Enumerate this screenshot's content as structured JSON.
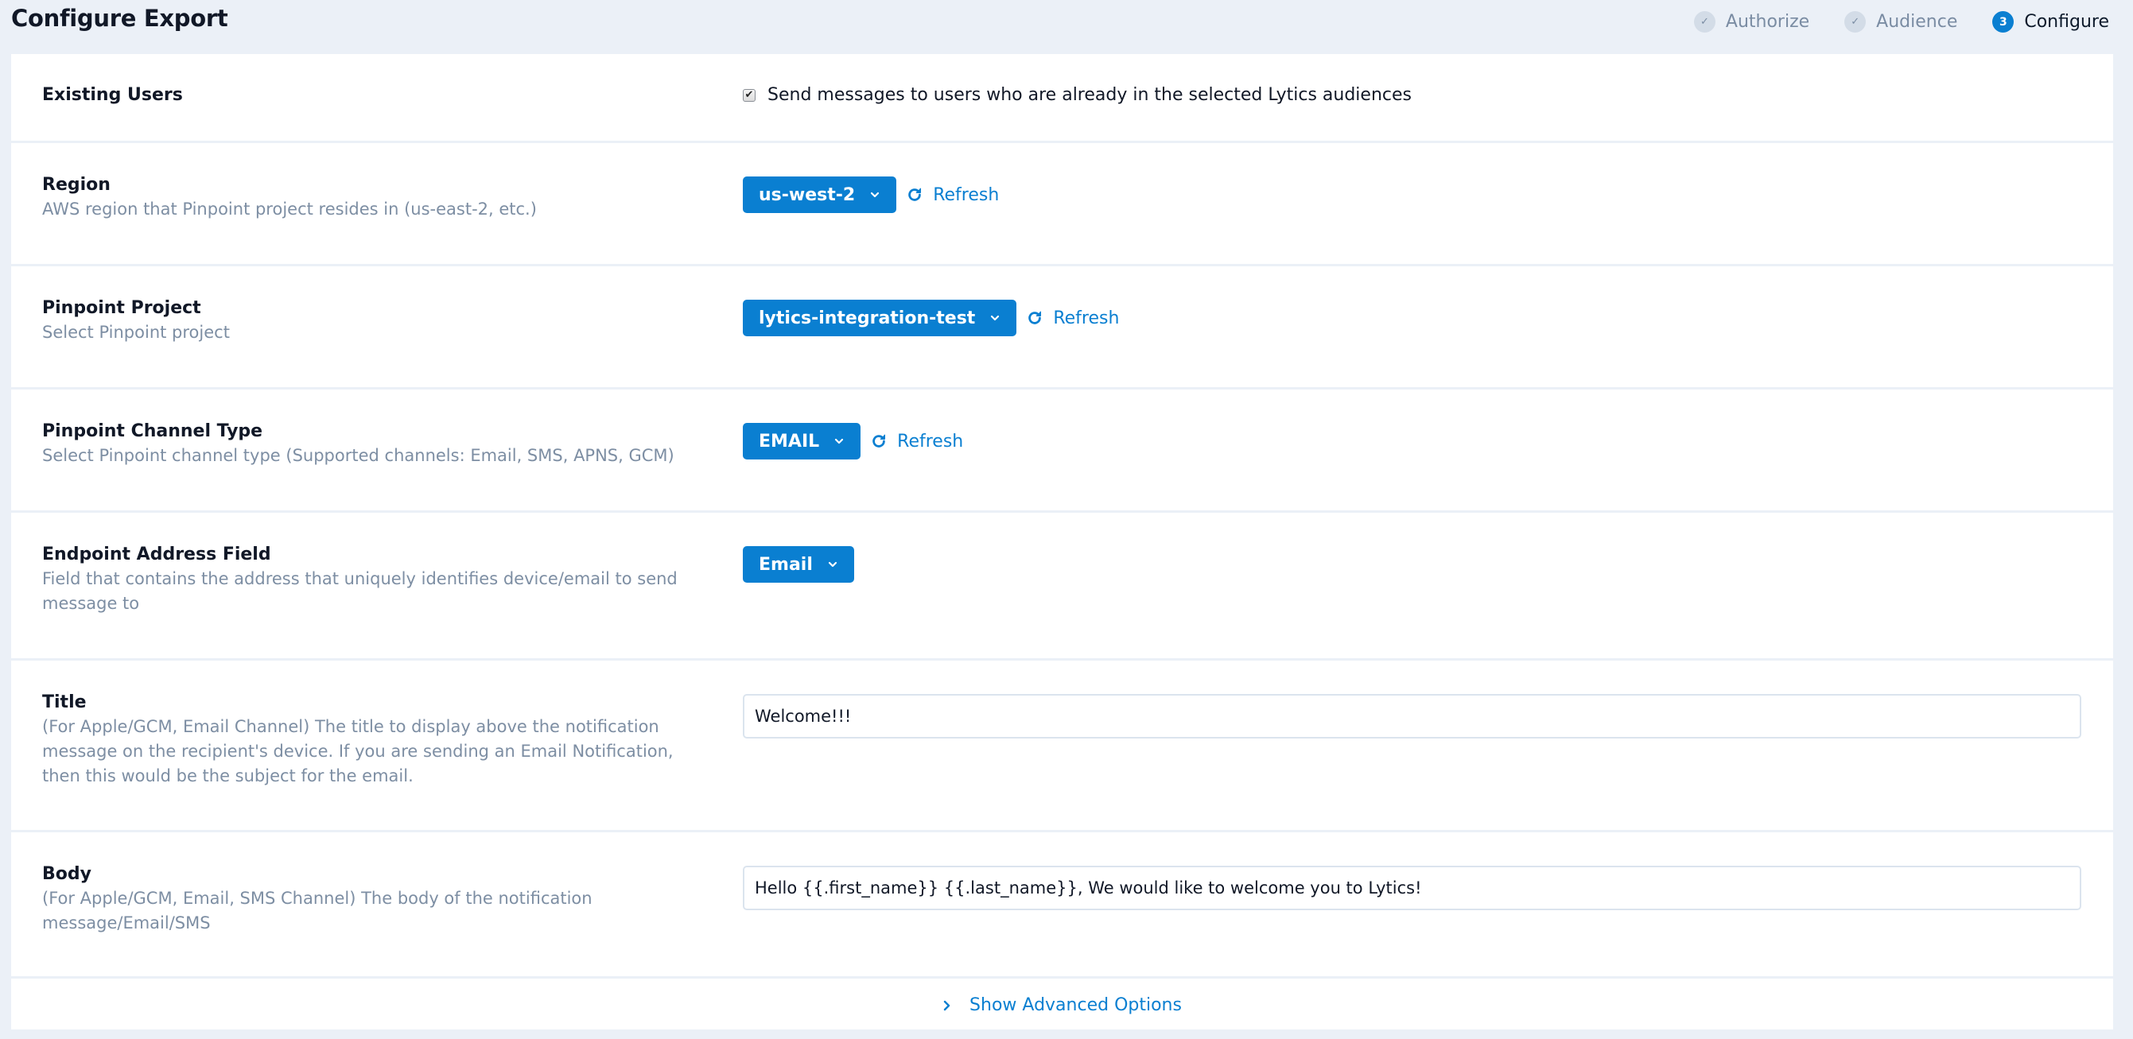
{
  "header": {
    "title": "Configure Export",
    "steps": [
      {
        "label": "Authorize",
        "badge": "✓",
        "state": "complete"
      },
      {
        "label": "Audience",
        "badge": "✓",
        "state": "complete"
      },
      {
        "label": "Configure",
        "badge": "3",
        "state": "active"
      }
    ]
  },
  "form": {
    "existing_users": {
      "label": "Existing Users",
      "checkbox_label": "Send messages to users who are already in the selected Lytics audiences",
      "checked": true
    },
    "region": {
      "label": "Region",
      "description": "AWS region that Pinpoint project resides in (us-east-2, etc.)",
      "selected": "us-west-2",
      "refresh_label": "Refresh"
    },
    "pinpoint_project": {
      "label": "Pinpoint Project",
      "description": "Select Pinpoint project",
      "selected": "lytics-integration-test",
      "refresh_label": "Refresh"
    },
    "channel_type": {
      "label": "Pinpoint Channel Type",
      "description": "Select Pinpoint channel type (Supported channels: Email, SMS, APNS, GCM)",
      "selected": "EMAIL",
      "refresh_label": "Refresh"
    },
    "endpoint_address": {
      "label": "Endpoint Address Field",
      "description": "Field that contains the address that uniquely identifies device/email to send message to",
      "selected": "Email"
    },
    "title": {
      "label": "Title",
      "description": "(For Apple/GCM, Email Channel) The title to display above the notification message on the recipient's device. If you are sending an Email Notification, then this would be the subject for the email.",
      "value": "Welcome!!!"
    },
    "body": {
      "label": "Body",
      "description": "(For Apple/GCM, Email, SMS Channel) The body of the notification message/Email/SMS",
      "value": "Hello {{.first_name}} {{.last_name}}, We would like to welcome you to Lytics!"
    },
    "advanced_label": "Show Advanced Options"
  },
  "colors": {
    "accent": "#0a7fd1",
    "background": "#ebf0f7",
    "muted_text": "#7d8ea3"
  }
}
